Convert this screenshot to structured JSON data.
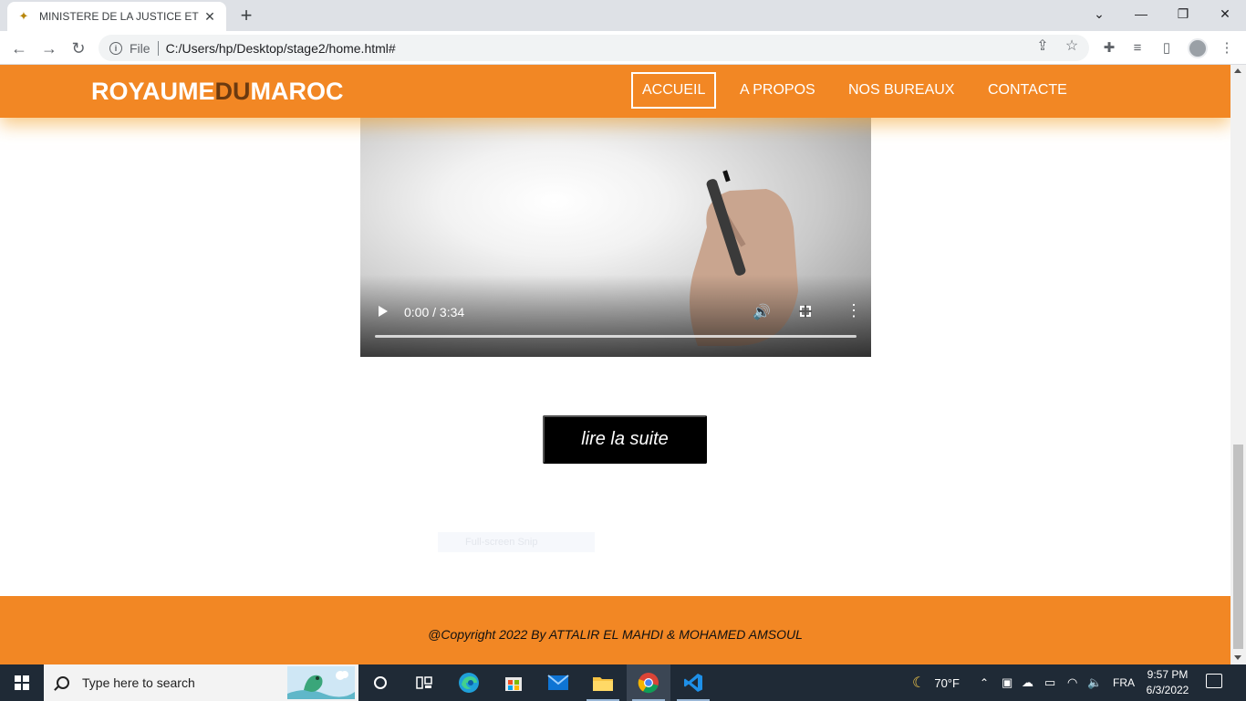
{
  "browser": {
    "tab_title": "MINISTERE DE LA JUSTICE ET DE",
    "tab_close": "✕",
    "new_tab": "+",
    "url_scheme": "File",
    "url": "C:/Users/hp/Desktop/stage2/home.html#"
  },
  "site": {
    "logo_left": "ROYAUME",
    "logo_mid": "DU",
    "logo_right": "MAROC",
    "nav": [
      {
        "label": "ACCUEIL",
        "active": true
      },
      {
        "label": "A PROPOS",
        "active": false
      },
      {
        "label": "NOS BUREAUX",
        "active": false
      },
      {
        "label": "CONTACTE",
        "active": false
      }
    ],
    "video": {
      "time": "0:00 / 3:34",
      "progress": 0
    },
    "read_more": "lire la suite",
    "snip_overlay": "Full-screen Snip",
    "footer_copyright": "@Copyright 2022 By ATTALIR EL MAHDI & MOHAMED AMSOUL"
  },
  "taskbar": {
    "search_placeholder": "Type here to search",
    "weather": "70°F",
    "language": "FRA",
    "time": "9:57 PM",
    "date": "6/3/2022",
    "apps": [
      "cortana-icon",
      "task-view-icon",
      "edge-icon",
      "store-icon",
      "mail-icon",
      "file-explorer-icon",
      "chrome-icon",
      "vscode-icon"
    ]
  },
  "colors": {
    "brand_orange": "#f28724",
    "logo_accent": "#6b3a10",
    "taskbar": "#1f2a36"
  }
}
